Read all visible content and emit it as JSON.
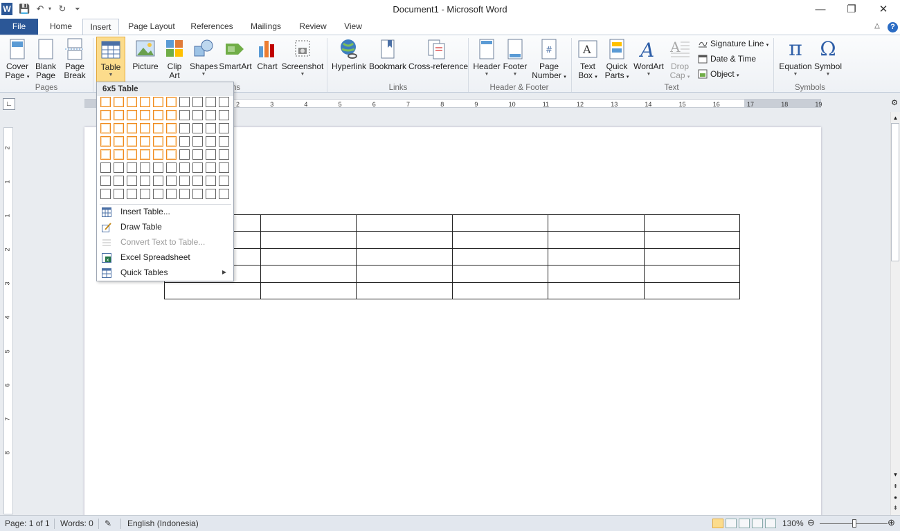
{
  "app": {
    "title": "Document1 - Microsoft Word"
  },
  "tabs": [
    {
      "label": "File"
    },
    {
      "label": "Home"
    },
    {
      "label": "Insert"
    },
    {
      "label": "Page Layout"
    },
    {
      "label": "References"
    },
    {
      "label": "Mailings"
    },
    {
      "label": "Review"
    },
    {
      "label": "View"
    }
  ],
  "ribbon": {
    "pages": {
      "cover": [
        "Cover",
        "Page"
      ],
      "blank": [
        "Blank",
        "Page"
      ],
      "break": [
        "Page",
        "Break"
      ],
      "group": "Pages"
    },
    "tables": {
      "table": "Table"
    },
    "illustrations": {
      "picture": "Picture",
      "clipart": [
        "Clip",
        "Art"
      ],
      "shapes": "Shapes",
      "smartart": "SmartArt",
      "chart": "Chart",
      "screenshot": "Screenshot",
      "group": "ions"
    },
    "links": {
      "hyperlink": "Hyperlink",
      "bookmark": "Bookmark",
      "crossref": "Cross-reference",
      "group": "Links"
    },
    "header_footer": {
      "header": "Header",
      "footer": "Footer",
      "page_number": [
        "Page",
        "Number"
      ],
      "group": "Header & Footer"
    },
    "text": {
      "textbox": [
        "Text",
        "Box"
      ],
      "quickparts": [
        "Quick",
        "Parts"
      ],
      "wordart": "WordArt",
      "dropcap": [
        "Drop",
        "Cap"
      ],
      "signature": "Signature Line",
      "datetime": "Date & Time",
      "object": "Object",
      "group": "Text"
    },
    "symbols": {
      "equation": "Equation",
      "symbol": "Symbol",
      "group": "Symbols"
    }
  },
  "ruler": {
    "ticks": [
      "2",
      "3",
      "4",
      "5",
      "6",
      "7",
      "8",
      "9",
      "10",
      "11",
      "12",
      "13",
      "14",
      "15",
      "16",
      "17",
      "18",
      "19"
    ],
    "vticks": [
      "2",
      "1",
      "1",
      "2",
      "3",
      "4",
      "5",
      "6",
      "7",
      "8"
    ]
  },
  "table_menu": {
    "header": "6x5 Table",
    "grid": {
      "cols": 10,
      "rows": 8,
      "selected_cols": 6,
      "selected_rows": 5
    },
    "items": [
      {
        "label": "Insert Table...",
        "disabled": false
      },
      {
        "label": "Draw Table",
        "disabled": false
      },
      {
        "label": "Convert Text to Table...",
        "disabled": true
      },
      {
        "label": "Excel Spreadsheet",
        "disabled": false
      },
      {
        "label": "Quick Tables",
        "disabled": false
      }
    ]
  },
  "document": {
    "table": {
      "rows": 5,
      "cols": 6
    }
  },
  "status": {
    "page": "Page: 1 of 1",
    "words": "Words: 0",
    "language": "English (Indonesia)",
    "zoom": "130%"
  },
  "colors": {
    "file_tab": "#2b5797",
    "highlight": "#f08a1e",
    "ribbon_border": "#c2ccd9"
  }
}
